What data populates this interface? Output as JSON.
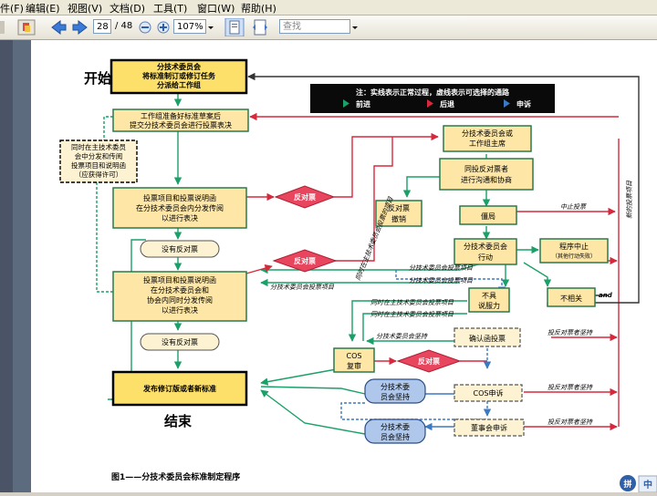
{
  "menu": {
    "file": "件(F)",
    "edit": "编辑(E)",
    "view": "视图(V)",
    "document": "文档(D)",
    "tools": "工具(T)",
    "window": "窗口(W)",
    "help": "帮助(H)"
  },
  "toolbar": {
    "page_current": "28",
    "page_total": "/ 48",
    "zoom": "107%",
    "search_placeholder": "查找"
  },
  "diagram": {
    "start": "开始",
    "end": "结束",
    "caption": "图1——分技术委员会标准制定程序",
    "legend": {
      "title": "注：实线表示正常过程，虚线表示可选择的通路",
      "forward": "前进",
      "back": "后退",
      "appeal": "申诉"
    },
    "nodes": {
      "n1": [
        "分技术委员会",
        "将标准制订或修订任务",
        "分派给工作组"
      ],
      "n2": [
        "工作组准备好标准草案后",
        "提交分技术委员会进行投票表决"
      ],
      "n3": [
        "同时在主技术委员",
        "会中分发和传阅",
        "投票项目和说明函",
        "（应获得许可）"
      ],
      "n4": [
        "投票项目和投票说明函",
        "在分技术委员会内分发传阅",
        "以进行表决"
      ],
      "n5": "没有反对票",
      "n6": [
        "投票项目和投票说明函",
        "在分技术委员会和",
        "协会内同时分发传阅",
        "以进行表决"
      ],
      "n7": "没有反对票",
      "n8": "发布修订版或者新标准",
      "n9": [
        "分技术委员会或",
        "工作组主席"
      ],
      "n10": [
        "同投反对票者",
        "进行沟通和协商"
      ],
      "n11": [
        "反对票",
        "撤销"
      ],
      "n12": "僵局",
      "n13": [
        "分技术委员会",
        "行动"
      ],
      "n14": [
        "程序中止",
        "（其他行动失败）"
      ],
      "n15": [
        "不具",
        "说服力"
      ],
      "n16": "不相关",
      "n17": "确认函投票",
      "n18": [
        "COS",
        "复审"
      ],
      "n19": [
        "分技术委",
        "员会坚持"
      ],
      "n20": "COS申诉",
      "n21": [
        "分技术委",
        "员会坚持"
      ],
      "n22": "董事会申诉",
      "dA": "反对票",
      "dB": "反对票",
      "dC": "反对票"
    },
    "labels": {
      "l1": "中止投票",
      "l2": "新的投票项目",
      "l3": "分技术委员会投票项目",
      "l4": "分技术委员会投票项目",
      "l5": "分技术委员会投票项目",
      "l6": "同时在主技术委员会投票项目",
      "l7": "同时在主技术委员会投票项目",
      "l8": "分技术委员会坚持",
      "l9": "投反对票者坚持",
      "l10": "投反对票者坚持",
      "l11": "投反对票者坚持",
      "l12": "同时在主技术委员会投票的项目",
      "and": "and"
    }
  },
  "colors": {
    "node_fill": "#fde6a6",
    "start_end_fill": "#fde06a",
    "diamond_fill": "#e8455e",
    "dashed_fill": "#fdf3d2",
    "blue_fill": "#aec7ea",
    "green_line": "#1aa068",
    "red_line": "#d8283c",
    "blue_line": "#3a7ac4"
  }
}
